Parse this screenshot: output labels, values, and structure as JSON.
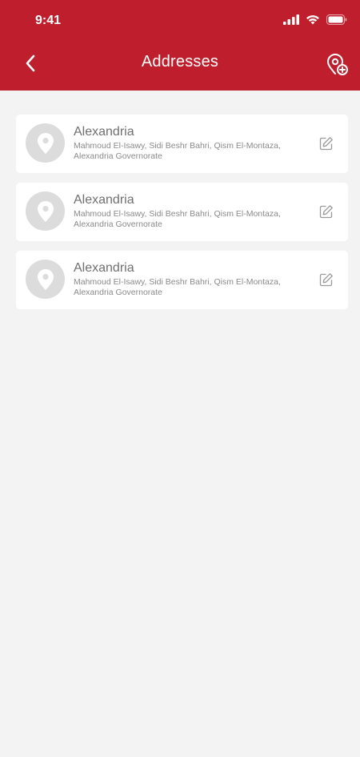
{
  "status_bar": {
    "time": "9:41"
  },
  "header": {
    "title": "Addresses",
    "back_icon": "chevron-left-icon",
    "add_icon": "map-pin-add-icon",
    "background_color": "#bf1f2d"
  },
  "addresses": [
    {
      "title": "Alexandria",
      "detail": "Mahmoud El-Isawy, Sidi Beshr Bahri, Qism El-Montaza, Alexandria Governorate"
    },
    {
      "title": "Alexandria",
      "detail": "Mahmoud El-Isawy, Sidi Beshr Bahri, Qism El-Montaza, Alexandria Governorate"
    },
    {
      "title": "Alexandria",
      "detail": "Mahmoud El-Isawy, Sidi Beshr Bahri, Qism El-Montaza, Alexandria Governorate"
    }
  ]
}
